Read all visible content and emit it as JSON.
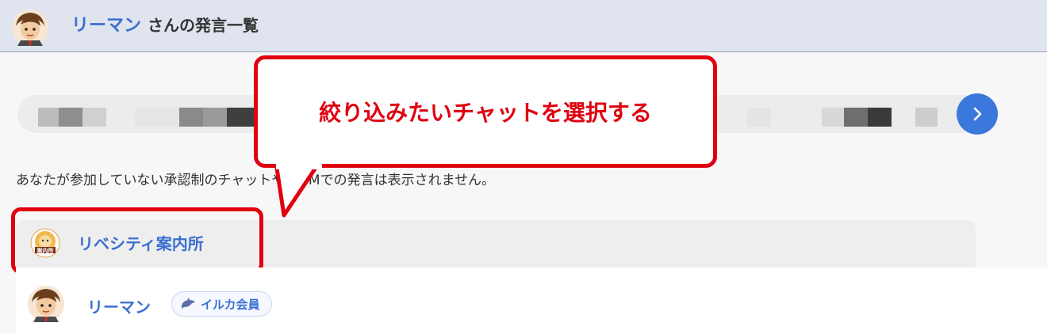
{
  "header": {
    "user_name": "リーマン",
    "title_suffix": "さんの発言一覧"
  },
  "chat_selector": {
    "next_icon": "chevron-right-icon"
  },
  "notice": "あなたが参加していない承認制のチャットや、DMでの発言は表示されません。",
  "group": {
    "name": "リベシティ案内所",
    "icon_label": "案内所"
  },
  "message": {
    "author": "リーマン",
    "badge": "イルカ会員",
    "badge_icon": "dolphin-icon"
  },
  "callout": {
    "text": "絞り込みたいチャットを選択する"
  },
  "colors": {
    "accent_blue": "#3a6fd0",
    "highlight_red": "#e00010",
    "header_bg": "#dfe4ef"
  }
}
